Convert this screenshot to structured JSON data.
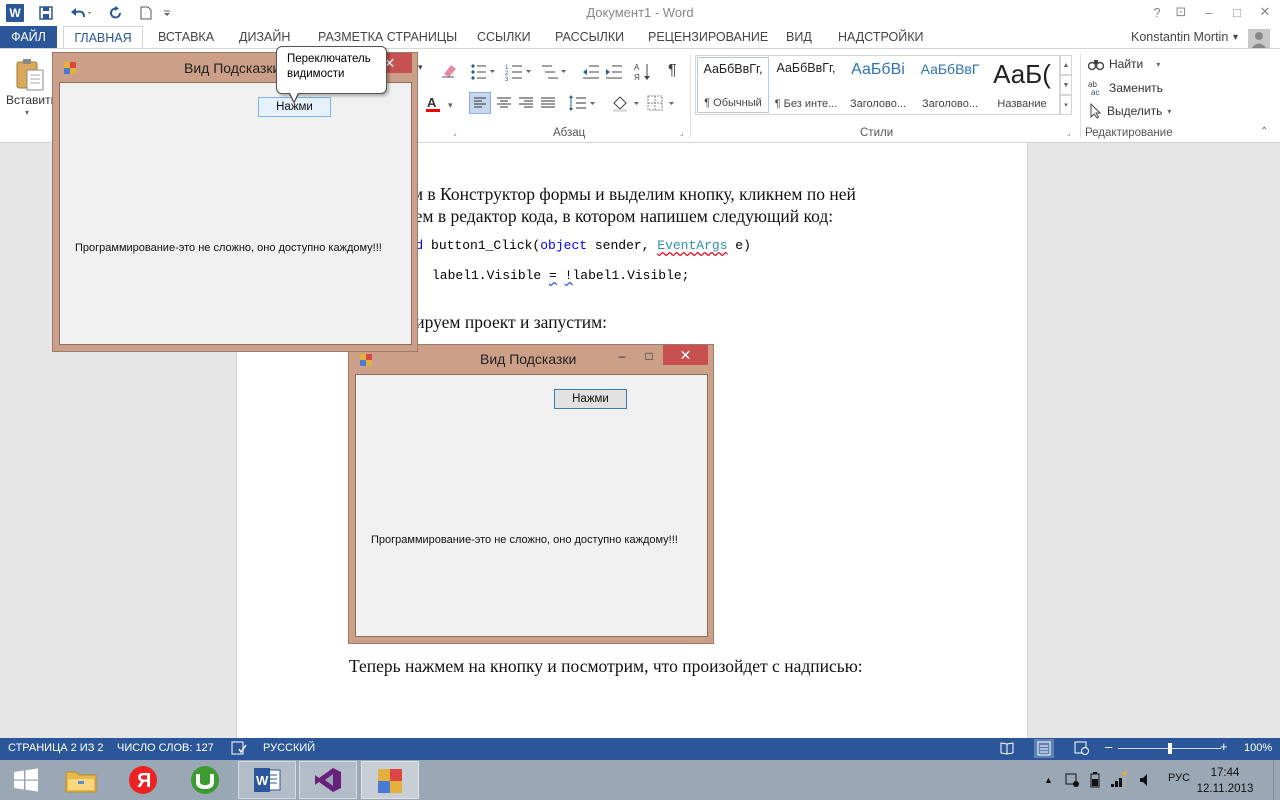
{
  "window": {
    "title": "Документ1 - Word",
    "help": "?",
    "restore": "⊡",
    "minimize": "–",
    "maximize": "□",
    "close": "✕"
  },
  "quick_access": {
    "app_icon": "W"
  },
  "tabs": [
    {
      "label": "ФАЙЛ"
    },
    {
      "label": "ГЛАВНАЯ"
    },
    {
      "label": "ВСТАВКА"
    },
    {
      "label": "ДИЗАЙН"
    },
    {
      "label": "РАЗМЕТКА СТРАНИЦЫ"
    },
    {
      "label": "ССЫЛКИ"
    },
    {
      "label": "РАССЫЛКИ"
    },
    {
      "label": "РЕЦЕНЗИРОВАНИЕ"
    },
    {
      "label": "ВИД"
    },
    {
      "label": "НАДСТРОЙКИ"
    }
  ],
  "user": {
    "name": "Konstantin Mortin",
    "dropdown": "▾"
  },
  "ribbon": {
    "paste_label": "Вставить",
    "paragraph_group": "Абзац",
    "styles_group": "Стили",
    "editing_group": "Редактирование",
    "styles": [
      {
        "sample": "АаБбВвГг,",
        "name": "¶ Обычный"
      },
      {
        "sample": "АаБбВвГг,",
        "name": "¶ Без инте..."
      },
      {
        "sample": "АаБбВі",
        "name": "Заголово..."
      },
      {
        "sample": "АаБбВвГ",
        "name": "Заголово..."
      },
      {
        "sample": "АаБ(",
        "name": "Название"
      }
    ],
    "editing": {
      "find": "Найти",
      "replace": "Заменить",
      "select": "Выделить"
    }
  },
  "document": {
    "para1_line1": "Перейдем в Конструктор формы и выделим кнопку, кликнем по ней",
    "para1_line2": "и перейдем в редактор кода, в котором напишем следующий код:",
    "code_kw1": "void",
    "code_sig": " button1_Click(",
    "code_kw2": "object",
    "code_sender": " sender, ",
    "code_type": "EventArgs",
    "code_e": " e)",
    "code_body_a": "label1.Visible ",
    "code_body_b": "=",
    "code_body_c": " ",
    "code_body_d": "!",
    "code_body_e": "label1.Visible;",
    "para2": "Скомпилируем проект и запустим:",
    "para3": "Теперь нажмем на кнопку и посмотрим, что произойдет с надписью:"
  },
  "form_front": {
    "title": "Вид Подсказки",
    "close": "✕",
    "button": "Нажми",
    "label": "Программирование-это не сложно, оно доступно каждому!!!"
  },
  "tooltip": {
    "line1": "Переключатель",
    "line2": "видимости"
  },
  "form_embedded": {
    "title": "Вид Подсказки",
    "minimize": "–",
    "maximize": "□",
    "close": "✕",
    "button": "Нажми",
    "label": "Программирование-это не сложно, оно доступно каждому!!!"
  },
  "status": {
    "page": "СТРАНИЦА 2 ИЗ 2",
    "words": "ЧИСЛО СЛОВ: 127",
    "language": "РУССКИЙ",
    "zoom": "100%",
    "zoom_minus": "–",
    "zoom_plus": "+",
    "zoom_level": 0.5
  },
  "taskbar": {
    "language": "РУС",
    "time": "17:44",
    "date": "12.11.2013"
  }
}
